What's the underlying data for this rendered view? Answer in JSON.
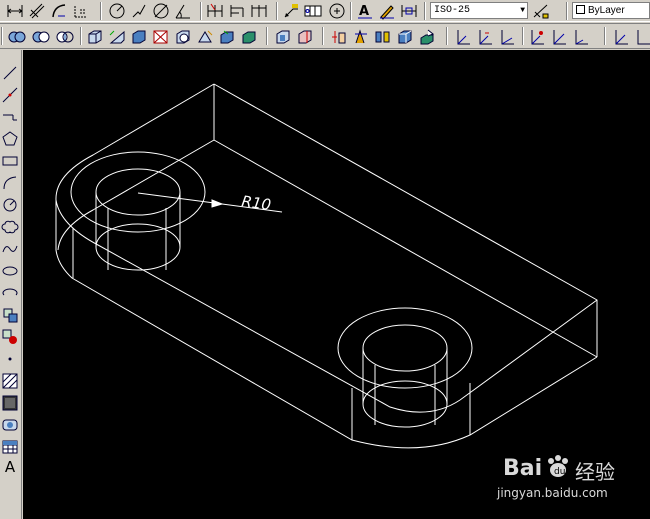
{
  "toolbar_top": {
    "icons": [
      "dim-linear-icon",
      "dim-aligned-icon",
      "dim-arc-icon",
      "dim-ordinate-icon",
      "dim-radius-icon",
      "dim-jogged-icon",
      "dim-diameter-icon",
      "dim-angular-icon",
      "quick-dim-icon",
      "dim-baseline-icon",
      "dim-continue-icon",
      "leader-icon",
      "tolerance-icon",
      "center-mark-icon",
      "dim-edit-icon",
      "dim-text-edit-icon",
      "dim-update-icon"
    ],
    "dimstyle_value": "ISO-25",
    "dimstyle_button_icon": "dimstyle-manager-icon",
    "layer_value": "ByLayer"
  },
  "toolbar_second": {
    "icons": [
      "union-icon",
      "subtract-icon",
      "intersect-icon",
      "box-icon",
      "wedge-icon",
      "cone-icon",
      "cylinder-icon",
      "sphere-icon",
      "torus-icon",
      "pyramid-icon",
      "extrude-icon",
      "revolve-icon",
      "slice-icon",
      "section-icon",
      "interfere-icon",
      "extract-edges-icon",
      "shell-icon",
      "view-top-icon",
      "view-bottom-icon",
      "view-left-icon",
      "view-right-icon",
      "view-front-icon",
      "view-back-icon",
      "view-iso-icon"
    ]
  },
  "left_toolbar": {
    "icons": [
      "line-icon",
      "construction-line-icon",
      "polyline-icon",
      "polygon-icon",
      "rectangle-icon",
      "arc-icon",
      "circle-icon",
      "revision-cloud-icon",
      "spline-icon",
      "ellipse-icon",
      "ellipse-arc-icon",
      "insert-block-icon",
      "make-block-icon",
      "point-icon",
      "hatch-icon",
      "gradient-icon",
      "region-icon",
      "table-icon",
      "multiline-text-icon"
    ],
    "text_tool_glyph": "A"
  },
  "drawing": {
    "dimension_text": "R10",
    "line_color": "#ffffff",
    "background": "#000000"
  },
  "watermark": {
    "brand": "Bai",
    "brand_suffix": "经验",
    "url": "jingyan.baidu.com"
  }
}
